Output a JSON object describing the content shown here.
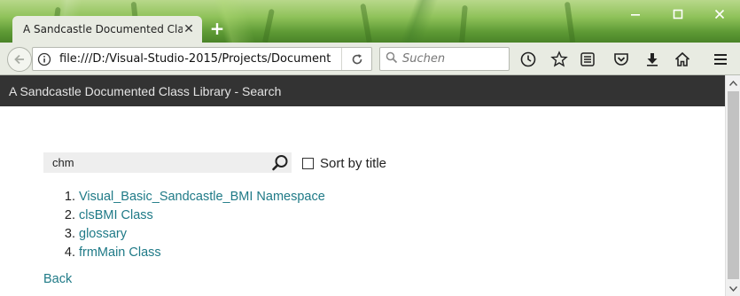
{
  "browser": {
    "tab_title": "A Sandcastle Documented Cla...",
    "url": "file:///D:/Visual-Studio-2015/Projects/Document",
    "search_placeholder": "Suchen"
  },
  "page": {
    "header_title": "A Sandcastle Documented Class Library - Search",
    "search_query": "chm",
    "sort_label": "Sort by title",
    "sort_checked": false,
    "results": [
      "Visual_Basic_Sandcastle_BMI Namespace",
      "clsBMI Class",
      "glossary",
      "frmMain Class"
    ],
    "back_label": "Back"
  },
  "colors": {
    "header_bg": "#333333",
    "link": "#1f7a87",
    "toolbar_bg": "#e8ebe2"
  }
}
